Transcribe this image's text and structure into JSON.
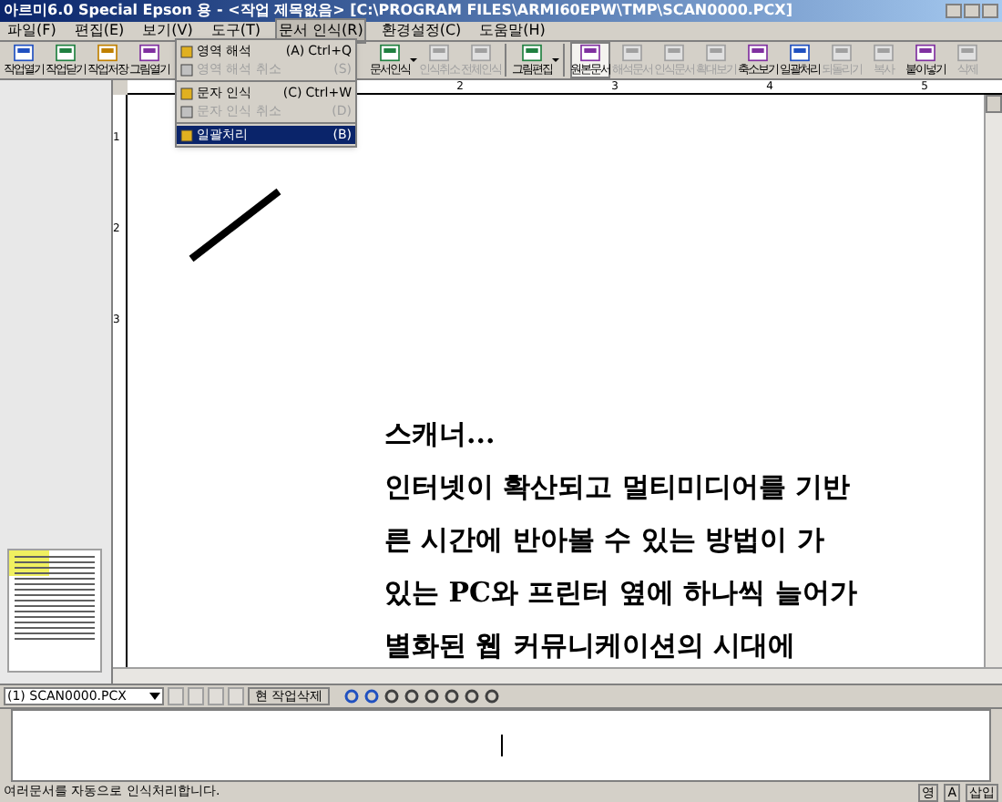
{
  "window": {
    "title": "아르미6.0 Special Epson 용 - <작업 제목없음> [C:\\PROGRAM FILES\\ARMI60EPW\\TMP\\SCAN0000.PCX]"
  },
  "menu": [
    {
      "label": "파일(F)",
      "selected": false
    },
    {
      "label": "편집(E)",
      "selected": false
    },
    {
      "label": "보기(V)",
      "selected": false
    },
    {
      "label": "도구(T)",
      "selected": false
    },
    {
      "label": "문서 인식(R)",
      "selected": true
    },
    {
      "label": "환경설정(C)",
      "selected": false
    },
    {
      "label": "도움말(H)",
      "selected": false
    }
  ],
  "dropdown": [
    {
      "kind": "item",
      "label": "영역 해석",
      "key": "(A)",
      "shortcut": "Ctrl+Q",
      "disabled": false,
      "selected": false
    },
    {
      "kind": "item",
      "label": "영역 해석 취소",
      "key": "(S)",
      "disabled": true,
      "selected": false
    },
    {
      "kind": "separator"
    },
    {
      "kind": "item",
      "label": "문자 인식",
      "key": "(C)",
      "shortcut": "Ctrl+W",
      "disabled": false,
      "selected": false
    },
    {
      "kind": "item",
      "label": "문자 인식 취소",
      "key": "(D)",
      "disabled": true,
      "selected": false
    },
    {
      "kind": "separator"
    },
    {
      "kind": "item",
      "label": "일괄처리",
      "key": "(B)",
      "disabled": false,
      "selected": true
    }
  ],
  "toolbar": [
    {
      "kind": "button",
      "label": "작업열기",
      "disabled": false,
      "pressed": false
    },
    {
      "kind": "button",
      "label": "작업닫기",
      "disabled": false,
      "pressed": false
    },
    {
      "kind": "button",
      "label": "작업저장",
      "disabled": false,
      "pressed": false
    },
    {
      "kind": "button",
      "label": "그림열기",
      "disabled": false,
      "pressed": false
    },
    {
      "kind": "covered"
    },
    {
      "kind": "dropbutton",
      "label": "문서인식",
      "disabled": false,
      "pressed": false
    },
    {
      "kind": "button",
      "label": "인식취소",
      "disabled": true,
      "pressed": false
    },
    {
      "kind": "button",
      "label": "전체인식",
      "disabled": true,
      "pressed": false
    },
    {
      "kind": "separator"
    },
    {
      "kind": "dropbutton",
      "label": "그림편집",
      "disabled": false,
      "pressed": false
    },
    {
      "kind": "separator"
    },
    {
      "kind": "button",
      "label": "원본문서",
      "disabled": false,
      "pressed": true
    },
    {
      "kind": "button",
      "label": "해석문서",
      "disabled": true,
      "pressed": false
    },
    {
      "kind": "button",
      "label": "인식문서",
      "disabled": true,
      "pressed": false
    },
    {
      "kind": "button",
      "label": "확대보기",
      "disabled": true,
      "pressed": false
    },
    {
      "kind": "button",
      "label": "축소보기",
      "disabled": false,
      "pressed": false
    },
    {
      "kind": "button",
      "label": "일괄처리",
      "disabled": false,
      "pressed": false
    },
    {
      "kind": "button",
      "label": "되돌리기",
      "disabled": true,
      "pressed": false
    },
    {
      "kind": "button",
      "label": "복사",
      "disabled": true,
      "pressed": false
    },
    {
      "kind": "button",
      "label": "붙이넣기",
      "disabled": false,
      "pressed": false
    },
    {
      "kind": "button",
      "label": "삭제",
      "disabled": true,
      "pressed": false
    }
  ],
  "ruler": {
    "top_marks": [
      "2",
      "3",
      "4",
      "5"
    ],
    "left_marks": [
      "1",
      "2",
      "3"
    ]
  },
  "document": {
    "lines": [
      "스캐너...",
      "인터넷이 확산되고 멀티미디어를 기반",
      "른 시간에 반아볼 수 있는 방법이 가",
      "있는 PC와 프린터 옆에 하나씩 늘어가",
      "별화된 웹 커뮤니케이션의 시대에"
    ]
  },
  "page_bar": {
    "file": "(1) SCAN0000.PCX",
    "delete_button": "현 작업삭제"
  },
  "status_bar": {
    "message": "여러문서를 자동으로 인식처리합니다.",
    "indicators": [
      "영",
      "A",
      "삽입"
    ]
  }
}
